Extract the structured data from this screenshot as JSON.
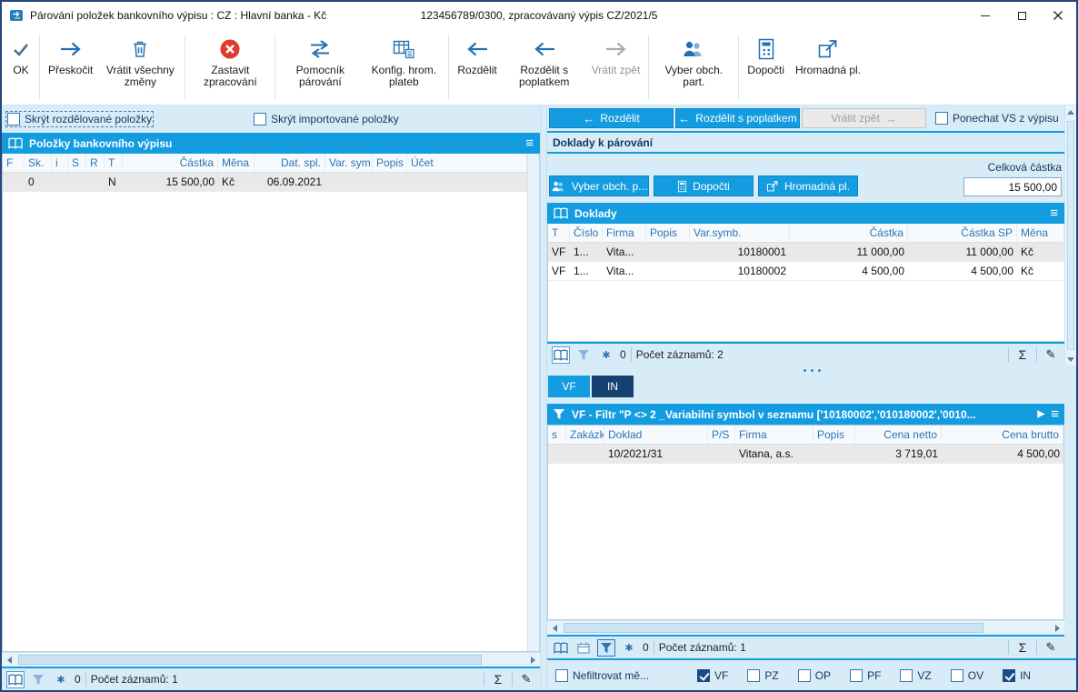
{
  "window": {
    "title": "Párování položek bankovního výpisu : CZ : Hlavní banka - Kč",
    "subtitle": "123456789/0300, zpracovávaný výpis CZ/2021/5"
  },
  "toolbar": {
    "ok": "OK",
    "skip": "Přeskočit",
    "revert_all": "Vrátit všechny změny",
    "stop": "Zastavit zpracování",
    "helper": "Pomocník párování",
    "config": "Konfig. hrom. plateb",
    "split": "Rozdělit",
    "split_fee": "Rozdělit s poplatkem",
    "undo": "Vrátit zpět",
    "partner": "Vyber obch. part.",
    "calc": "Dopočti",
    "bulk": "Hromadná pl."
  },
  "left": {
    "hide_split": "Skrýt rozdělované položky",
    "hide_imported": "Skrýt importované položky",
    "header": "Položky bankovního výpisu",
    "cols": [
      "F",
      "Sk.",
      "i",
      "S",
      "R",
      "T",
      "Částka",
      "Měna",
      "Dat. spl.",
      "Var. sym",
      "Popis",
      "Účet"
    ],
    "rows": [
      [
        "",
        "0",
        "",
        "",
        "",
        "N",
        "15 500,00",
        "Kč",
        "06.09.2021",
        "",
        "",
        ""
      ]
    ],
    "count": "0",
    "records": "Počet záznamů: 1"
  },
  "right": {
    "split_btn": "Rozdělit",
    "split_fee_btn": "Rozdělit s poplatkem",
    "undo_btn": "Vrátit zpět",
    "keep_vs": "Ponechat VS z výpisu",
    "section": "Doklady k párování",
    "total_label": "Celková částka",
    "total_value": "15 500,00",
    "partner_btn": "Vyber obch. p...",
    "calc_btn": "Dopočti",
    "bulk_btn": "Hromadná pl.",
    "docs": {
      "header": "Doklady",
      "cols": [
        "T",
        "Číslo",
        "Firma",
        "Popis",
        "Var.symb.",
        "Částka",
        "Částka SP",
        "Měna"
      ],
      "rows": [
        [
          "VF",
          "1...",
          "Vita...",
          "",
          "10180001",
          "11 000,00",
          "11 000,00",
          "Kč"
        ],
        [
          "VF",
          "1...",
          "Vita...",
          "",
          "10180002",
          "4 500,00",
          "4 500,00",
          "Kč"
        ]
      ],
      "count": "0",
      "records": "Počet záznamů: 2"
    },
    "tab_vf": "VF",
    "tab_in": "IN",
    "filter_text": "VF - Filtr \"P <> 2 _Variabilní symbol v seznamu ['10180002','010180002','0010...",
    "inv": {
      "cols": [
        "s",
        "Zakázka",
        "Doklad",
        "P/S",
        "Firma",
        "Popis",
        "Cena netto",
        "Cena brutto"
      ],
      "rows": [
        [
          "",
          "",
          "10/2021/31",
          "",
          "Vitana, a.s.",
          "",
          "3 719,01",
          "4 500,00"
        ]
      ],
      "count": "0",
      "records": "Počet záznamů: 1"
    },
    "nofilter": "Nefiltrovat mě...",
    "filters": [
      {
        "label": "VF",
        "checked": true
      },
      {
        "label": "PZ",
        "checked": false
      },
      {
        "label": "OP",
        "checked": false
      },
      {
        "label": "PF",
        "checked": false
      },
      {
        "label": "VZ",
        "checked": false
      },
      {
        "label": "OV",
        "checked": false
      },
      {
        "label": "IN",
        "checked": true
      }
    ]
  },
  "icons": {
    "menu": "≡",
    "sum": "Σ",
    "edit": "✎",
    "snowflake": "✱",
    "play": "▶",
    "arrow_left": "←",
    "arrow_right": "→"
  },
  "colors": {
    "accent": "#149ce0",
    "navy": "#164070",
    "stop_red": "#e23a2e"
  }
}
